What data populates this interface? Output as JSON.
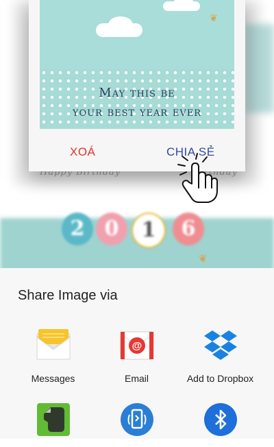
{
  "dialog": {
    "card_text_line1": "May this be",
    "card_text_line2": "your best year ever",
    "delete_label": "XOÁ",
    "share_label": "CHIA SẺ"
  },
  "background": {
    "handwriting_left": "Happy Birthday",
    "handwriting_right": "Birthday",
    "year_digits": [
      "2",
      "0",
      "1",
      "6"
    ]
  },
  "share_sheet": {
    "title": "Share Image via",
    "items": [
      {
        "label": "Messages",
        "icon": "messages-icon"
      },
      {
        "label": "Email",
        "icon": "email-icon"
      },
      {
        "label": "Add to Dropbox",
        "icon": "dropbox-icon"
      },
      {
        "label": "",
        "icon": "evernote-icon"
      },
      {
        "label": "",
        "icon": "quick-connect-icon"
      },
      {
        "label": "",
        "icon": "bluetooth-icon"
      }
    ]
  },
  "colors": {
    "delete": "#e0332c",
    "share": "#2f4aa2",
    "card_bg": "#a7dcd8",
    "sheet_bg": "#f7f7f7"
  }
}
